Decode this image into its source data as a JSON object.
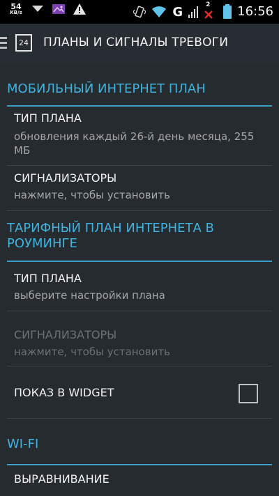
{
  "status_bar": {
    "speed_value": "54",
    "speed_unit": "KB/s",
    "network_type": "G",
    "sim_number": "2",
    "time": "16:56",
    "icons": [
      "download-icon",
      "image-icon",
      "warning-icon",
      "vibrate-icon",
      "wifi-icon",
      "signal-icon",
      "no-signal-icon",
      "battery-icon"
    ]
  },
  "action_bar": {
    "calendar_day": "24",
    "title": "ПЛАНЫ И СИГНАЛЫ ТРЕВОГИ"
  },
  "sections": {
    "mobile": {
      "title": "МОБИЛЬНЫЙ ИНТЕРНЕТ ПЛАН",
      "plan_type": {
        "title": "ТИП ПЛАНА",
        "summary": "обновления каждый 26-й день месяца, 255 МБ"
      },
      "alarms": {
        "title": "СИГНАЛИЗАТОРЫ",
        "summary": "нажмите, чтобы установить"
      }
    },
    "roaming": {
      "title": "ТАРИФНЫЙ ПЛАН ИНТЕРНЕТА В РОУМИНГЕ",
      "plan_type": {
        "title": "ТИП ПЛАНА",
        "summary": "выберите настройки плана"
      },
      "alarms": {
        "title": "СИГНАЛИЗАТОРЫ",
        "summary": "нажмите, чтобы установить",
        "enabled": false
      },
      "widget": {
        "title": "ПОКАЗ В WIDGET",
        "checked": false
      }
    },
    "wifi": {
      "title": "WI-FI",
      "next_item_partial": "ВЫРАВНИВАНИЕ"
    }
  },
  "colors": {
    "accent": "#3fb2de",
    "background": "#262b30",
    "status_bar": "#000000"
  }
}
